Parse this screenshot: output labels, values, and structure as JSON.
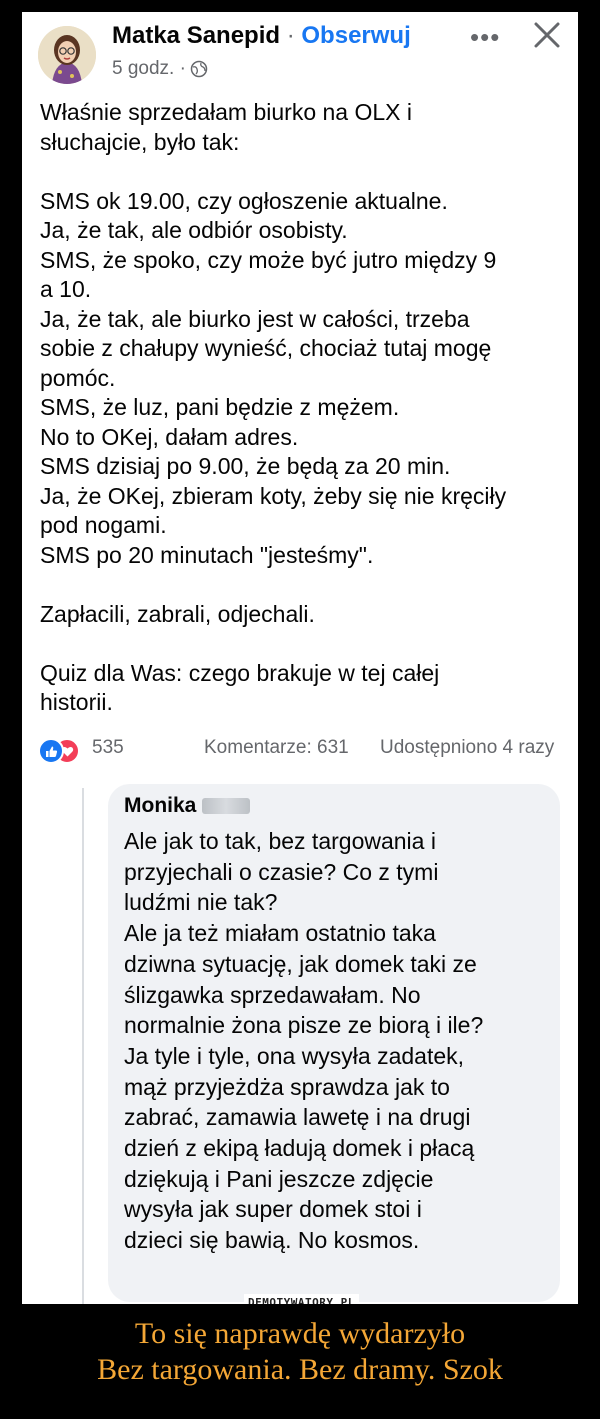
{
  "post": {
    "author": "Matka Sanepid",
    "separator": "·",
    "follow_label": "Obserwuj",
    "time": "5 godz. ·",
    "menu_glyph": "•••",
    "text_paragraphs": [
      [
        "Właśnie sprzedałam biurko na OLX i",
        "słuchajcie, było tak:"
      ],
      [
        "SMS ok 19.00, czy ogłoszenie aktualne.",
        "Ja, że tak, ale odbiór osobisty.",
        "SMS, że spoko, czy może być jutro między 9",
        "a 10.",
        "Ja, że tak, ale biurko jest w całości, trzeba",
        "sobie z chałupy wynieść, chociaż tutaj mogę",
        "pomóc.",
        "SMS, że luz, pani będzie z mężem.",
        "No to OKej, dałam adres.",
        "SMS dzisiaj po 9.00, że będą za 20 min.",
        "Ja, że OKej, zbieram koty, żeby się nie kręciły",
        "pod nogami.",
        "SMS po 20 minutach \"jesteśmy\"."
      ],
      [
        "Zapłacili, zabrali, odjechali."
      ],
      [
        "Quiz dla Was: czego brakuje w tej całej",
        "historii."
      ]
    ],
    "reaction_count": "535",
    "comments_label": "Komentarze: 631",
    "shares_label": "Udostępniono 4 razy",
    "colors": {
      "link": "#1877f2",
      "secondary": "#65676b",
      "like": "#1877f2",
      "love": "#f33e58"
    }
  },
  "comment": {
    "author": "Monika",
    "lines": [
      "Ale jak to tak, bez targowania i",
      "przyjechali o czasie? Co z tymi",
      "ludźmi nie tak?",
      "Ale ja też miałam ostatnio taka",
      "dziwna sytuację, jak domek taki ze",
      "ślizgawka sprzedawałam. No",
      "normalnie żona pisze ze biorą i ile?",
      "Ja tyle i tyle, ona wysyła zadatek,",
      "mąż przyjeżdża sprawdza jak to",
      "zabrać, zamawia lawetę i na drugi",
      "dzień z ekipą ładują domek i płacą",
      "dziękują i Pani jeszcze zdjęcie",
      "wysyła jak super domek stoi i",
      "dzieci się bawią. No kosmos."
    ]
  },
  "watermark": "DEMOTYWATORY.PL",
  "caption": {
    "line1": "To się naprawdę wydarzyło",
    "line2": "Bez targowania. Bez dramy. Szok",
    "color": "#f4a736"
  }
}
